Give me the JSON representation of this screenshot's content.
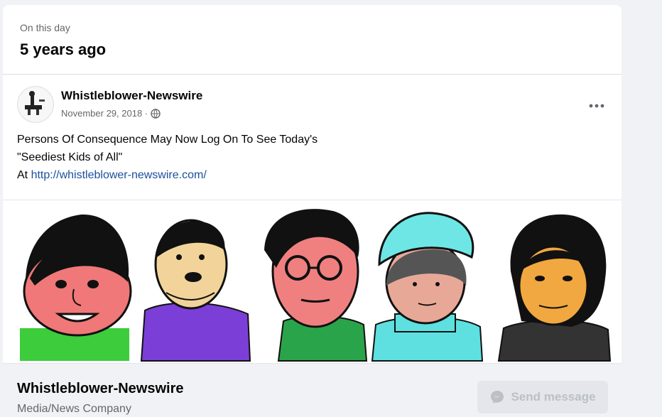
{
  "memory": {
    "label": "On this day",
    "title": "5 years ago"
  },
  "post": {
    "author": "Whistleblower-Newswire",
    "date": "November 29, 2018 ·",
    "text_line1": "Persons Of Consequence May Now Log On To See Today's",
    "text_line2": "\"Seediest Kids of All\"",
    "text_line3_prefix": "At ",
    "link": "http://whistleblower-newswire.com/",
    "privacy_icon": "globe-icon",
    "more_icon": "more-options-icon"
  },
  "footer": {
    "page_name": "Whistleblower-Newswire",
    "category": "Media/News Company",
    "send_button_label": "Send message",
    "send_icon": "messenger-icon"
  },
  "colors": {
    "link": "#1b4f9c",
    "secondary_text": "#65676b",
    "button_bg": "#e4e6eb",
    "button_text": "#bcc0c4"
  }
}
